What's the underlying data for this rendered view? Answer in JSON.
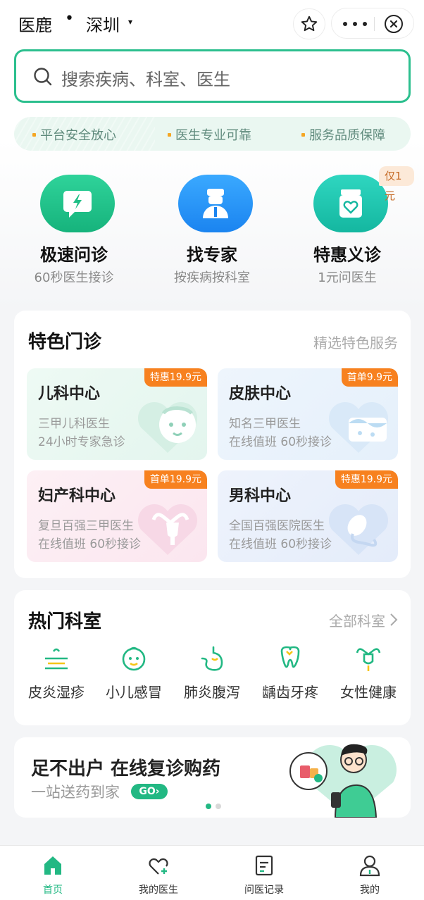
{
  "header": {
    "app_name": "医鹿",
    "dot": "•",
    "city": "深圳",
    "city_caret": "▾"
  },
  "search": {
    "placeholder": "搜索疾病、科室、医生"
  },
  "trust": [
    "平台安全放心",
    "医生专业可靠",
    "服务品质保障"
  ],
  "quick_entries": [
    {
      "title": "极速问诊",
      "sub": "60秒医生接诊",
      "icon": "chat-lightning-icon",
      "color": "#1fbf86"
    },
    {
      "title": "找专家",
      "sub": "按疾病按科室",
      "icon": "doctor-icon",
      "color": "#1e90ff"
    },
    {
      "title": "特惠义诊",
      "sub": "1元问医生",
      "icon": "heart-jar-icon",
      "color": "#1dbfa6",
      "tag": "仅1元"
    }
  ],
  "featured": {
    "title": "特色门诊",
    "more": "精选特色服务",
    "clinics": [
      {
        "name": "儿科中心",
        "badge": "特惠19.9元",
        "line1": "三甲儿科医生",
        "line2": "24小时专家急诊",
        "icon": "baby-face-icon"
      },
      {
        "name": "皮肤中心",
        "badge": "首单9.9元",
        "line1": "知名三甲医生",
        "line2": "在线值班 60秒接诊",
        "icon": "skin-icon"
      },
      {
        "name": "妇产科中心",
        "badge": "首单19.9元",
        "line1": "复旦百强三甲医生",
        "line2": "在线值班 60秒接诊",
        "icon": "uterus-icon"
      },
      {
        "name": "男科中心",
        "badge": "特惠19.9元",
        "line1": "全国百强医院医生",
        "line2": "在线值班 60秒接诊",
        "icon": "sperm-icon"
      }
    ]
  },
  "departments": {
    "title": "热门科室",
    "more": "全部科室",
    "items": [
      {
        "label": "皮炎湿疹",
        "icon": "skin-layer-icon"
      },
      {
        "label": "小儿感冒",
        "icon": "baby-icon"
      },
      {
        "label": "肺炎腹泻",
        "icon": "stomach-icon"
      },
      {
        "label": "龋齿牙疼",
        "icon": "tooth-icon"
      },
      {
        "label": "女性健康",
        "icon": "uterus-icon"
      }
    ]
  },
  "banner": {
    "title": "足不出户 在线复诊购药",
    "sub": "一站送药到家",
    "go": "GO›"
  },
  "tabbar": [
    {
      "label": "首页",
      "icon": "home-icon",
      "active": true
    },
    {
      "label": "我的医生",
      "icon": "heart-plus-icon",
      "active": false
    },
    {
      "label": "问医记录",
      "icon": "record-icon",
      "active": false
    },
    {
      "label": "我的",
      "icon": "person-icon",
      "active": false
    }
  ],
  "colors": {
    "accent": "#22b883",
    "badge": "#f7811f"
  }
}
